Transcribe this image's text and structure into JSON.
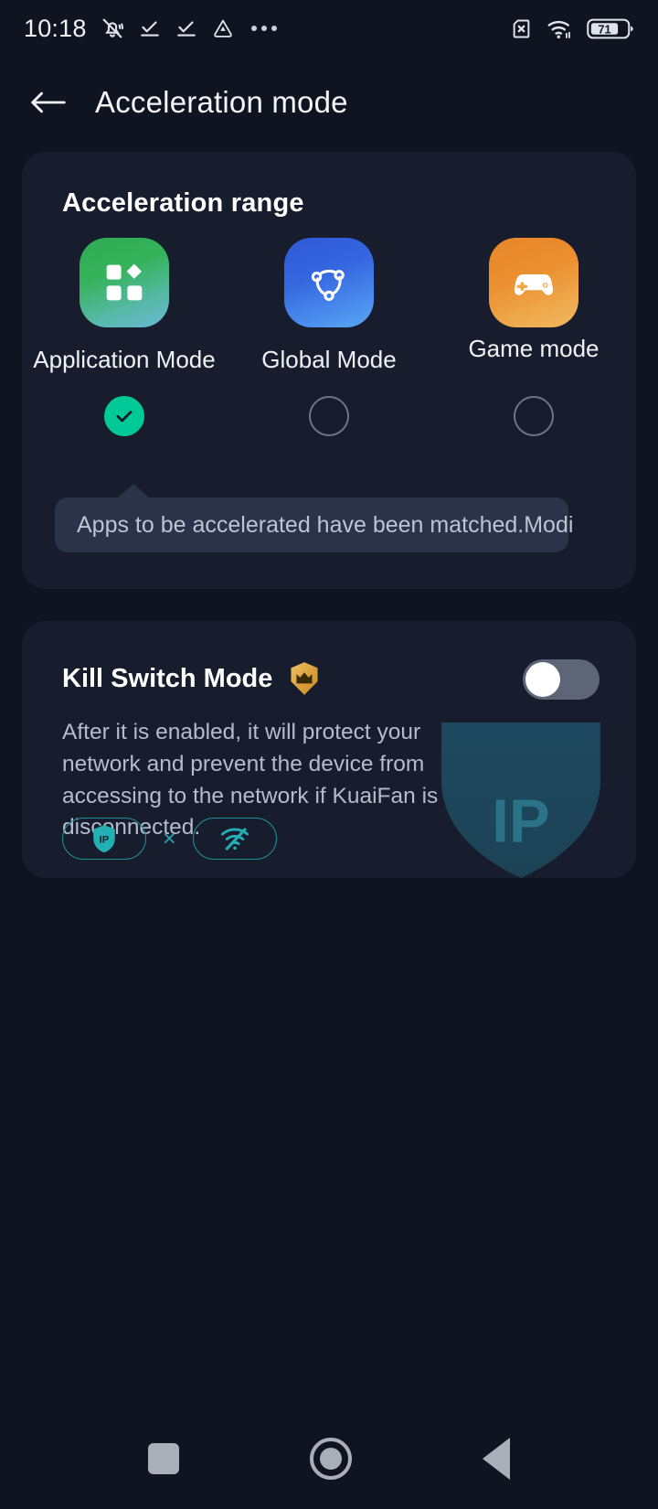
{
  "status_bar": {
    "time": "10:18",
    "left_icons": [
      "bell-muted-icon",
      "check-underline-icon",
      "check-underline-icon",
      "triangle-drive-icon",
      "more-dots-icon"
    ],
    "right_icons": [
      "sim-card-off-icon",
      "wifi-icon",
      "battery-icon"
    ],
    "battery_level": "71"
  },
  "app_bar": {
    "back_icon": "arrow-left-icon",
    "title": "Acceleration mode"
  },
  "acceleration_range": {
    "title": "Acceleration range",
    "modes": [
      {
        "label": "Application Mode",
        "icon": "apps-grid-icon",
        "selected": true,
        "color": "#35b35b"
      },
      {
        "label": "Global Mode",
        "icon": "network-nodes-icon",
        "selected": false,
        "color": "#3566e0"
      },
      {
        "label": "Game mode",
        "icon": "gamepad-icon",
        "selected": false,
        "color": "#ea8f2f"
      }
    ],
    "tooltip": {
      "text": "Apps to be accelerated have been matched.Modi",
      "chevron_icon": "chevron-right-icon"
    },
    "accent_color": "#00c896"
  },
  "kill_switch": {
    "title": "Kill Switch Mode",
    "badge_icon": "crown-badge-icon",
    "enabled": false,
    "description": "After it is enabled, it will protect your network and prevent the device from accessing to the network if KuaiFan is disconnected.",
    "pills": [
      {
        "icon": "ip-shield-icon"
      },
      {
        "icon": "wifi-off-icon"
      }
    ],
    "separator": "×",
    "watermark_label": "IP",
    "accent_color": "#2ea0a6"
  },
  "nav_bar": {
    "items": [
      {
        "icon": "recents-square-icon"
      },
      {
        "icon": "home-circle-icon"
      },
      {
        "icon": "back-triangle-icon"
      }
    ]
  }
}
